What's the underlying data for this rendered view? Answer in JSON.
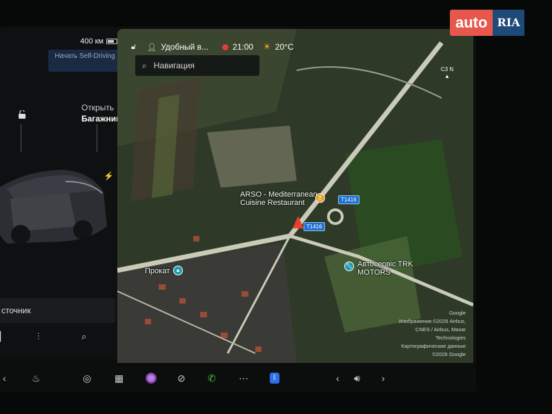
{
  "status": {
    "range": "400 км",
    "profile": "Удобный в...",
    "time": "21:00",
    "temperature": "20°C"
  },
  "left_panel": {
    "self_driving_button": "Начать Self-Driving",
    "trunk_line1": "Открыть",
    "trunk_line2": "Багажник",
    "source_label": "сточник"
  },
  "map": {
    "search_placeholder": "Навигация",
    "compass_label": "C3 N",
    "pois": {
      "restaurant_line1": "ARSO - Mediterranean",
      "restaurant_line2": "Cuisine Restaurant",
      "rental": "Прокат",
      "service_line1": "Автосервіс TRK",
      "service_line2": "MOTORS"
    },
    "road_tags": [
      "T1416",
      "T1416"
    ],
    "attribution": [
      "Google",
      "Изображения ©2026 Airbus,",
      "CNES / Airbus, Maxar",
      "Technologies",
      "Картографические данные",
      "©2026 Google"
    ]
  },
  "watermark": {
    "part1": "auto",
    "part2": "RIA"
  },
  "icons": {
    "lock": "unlock-icon",
    "bolt": "charging-bolt-icon",
    "eq": "equalizer-icon",
    "search": "search-icon"
  },
  "colors": {
    "accent": "#2c6fe6",
    "marker": "#e8402f",
    "record": "#e23b3b"
  }
}
